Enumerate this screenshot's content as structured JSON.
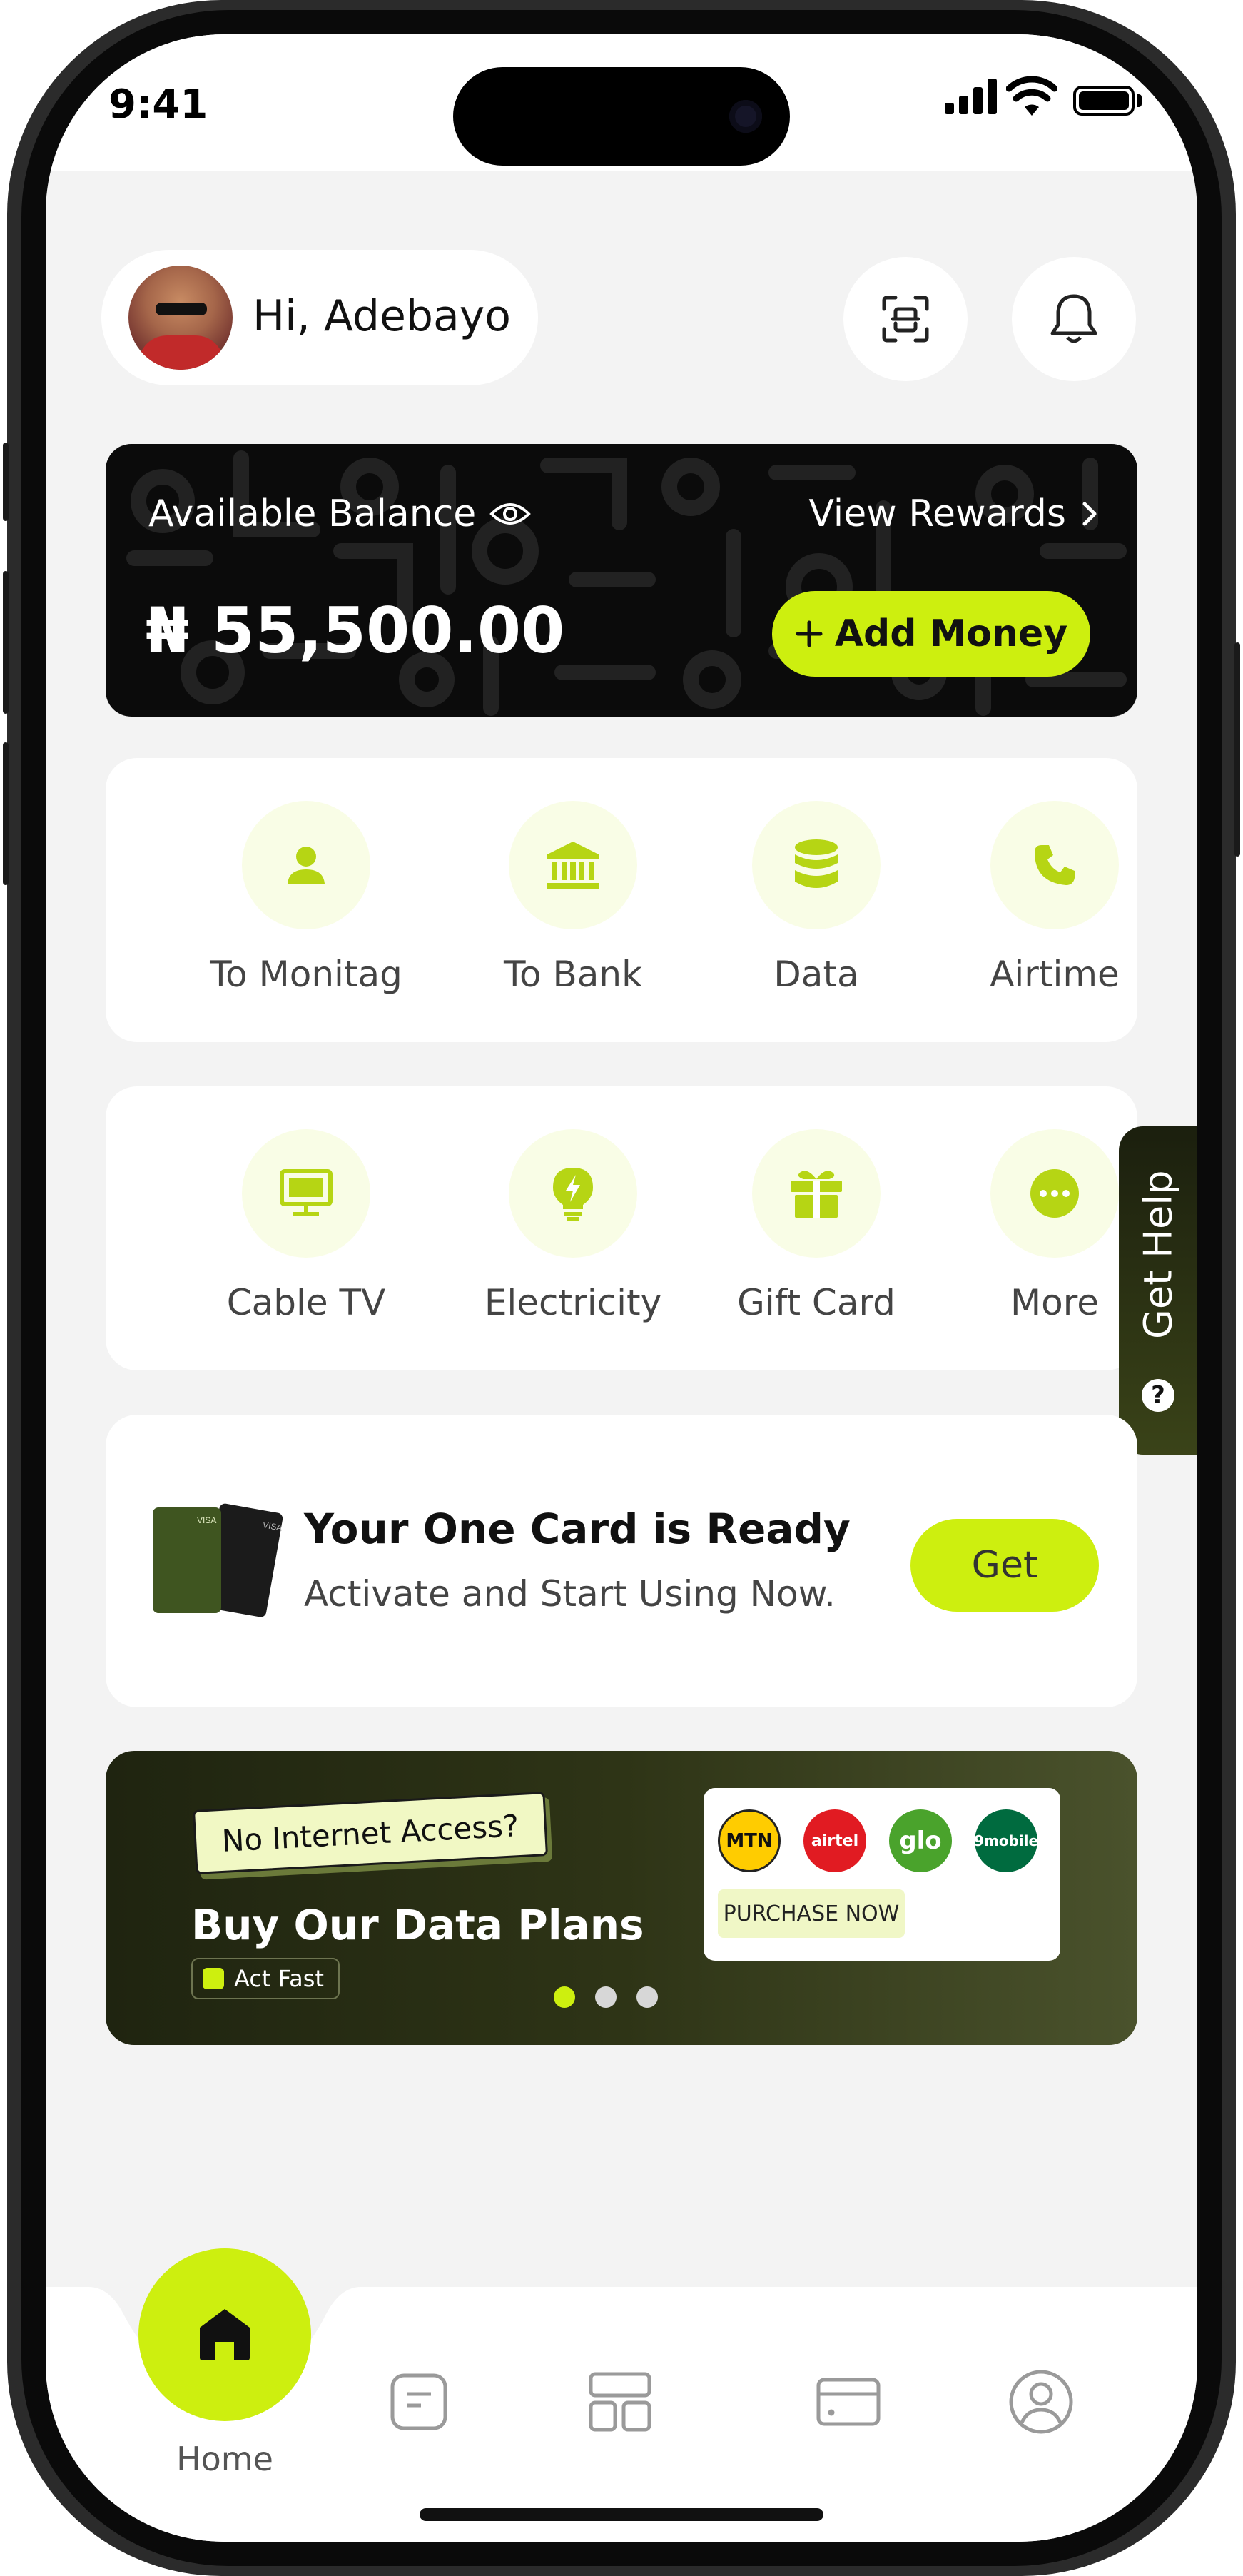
{
  "status_bar": {
    "time": "9:41"
  },
  "header": {
    "greeting": "Hi, Adebayo",
    "scan_icon": "scan-icon",
    "notification_icon": "bell-icon"
  },
  "balance_card": {
    "label": "Available Balance",
    "amount": "₦ 55,500.00",
    "rewards_link": "View Rewards",
    "add_money_label": "Add Money"
  },
  "services_row1": [
    {
      "label": "To Monitag",
      "icon": "user-icon"
    },
    {
      "label": "To Bank",
      "icon": "bank-icon"
    },
    {
      "label": "Data",
      "icon": "database-icon"
    },
    {
      "label": "Airtime",
      "icon": "phone-icon"
    }
  ],
  "services_row2": [
    {
      "label": "Cable TV",
      "icon": "tv-icon"
    },
    {
      "label": "Electricity",
      "icon": "bulb-icon"
    },
    {
      "label": "Gift Card",
      "icon": "gift-icon"
    },
    {
      "label": "More",
      "icon": "more-icon"
    }
  ],
  "help_tab": {
    "label": "Get Help"
  },
  "one_card": {
    "title": "Your One Card is Ready",
    "subtitle": "Activate and Start Using Now.",
    "button_label": "Get"
  },
  "promo_banner": {
    "tag": "No Internet Access?",
    "title": "Buy Our Data Plans",
    "pill": "Act Fast",
    "networks": [
      "MTN",
      "airtel",
      "glo",
      "9mobile"
    ],
    "purchase_label": "PURCHASE NOW",
    "active_slide": 1,
    "slide_count": 3
  },
  "tab_bar": {
    "home_label": "Home",
    "items": [
      "home-icon",
      "document-icon",
      "dashboard-icon",
      "card-icon",
      "profile-icon"
    ]
  },
  "colors": {
    "accent": "#cdef0f",
    "dark": "#0b0b0b",
    "background": "#f3f3f3"
  }
}
